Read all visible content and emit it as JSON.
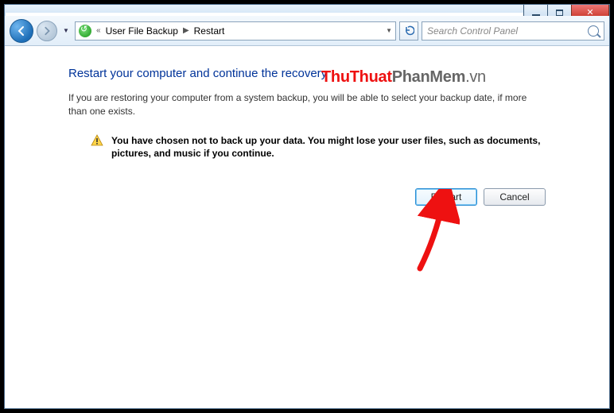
{
  "breadcrumb": {
    "item1": "User File Backup",
    "item2": "Restart"
  },
  "search": {
    "placeholder": "Search Control Panel"
  },
  "page": {
    "heading": "Restart your computer and continue the recovery",
    "body": "If you are restoring your computer from a system backup, you will be able to select your backup date, if more than one exists.",
    "warning": "You have chosen not to back up your data. You might lose your user files, such as documents, pictures, and music if you continue."
  },
  "buttons": {
    "restart": "Restart",
    "cancel": "Cancel"
  },
  "watermark": {
    "a": "ThuThuat",
    "b": "Phan",
    "c": "Mem",
    "d": ".vn"
  }
}
